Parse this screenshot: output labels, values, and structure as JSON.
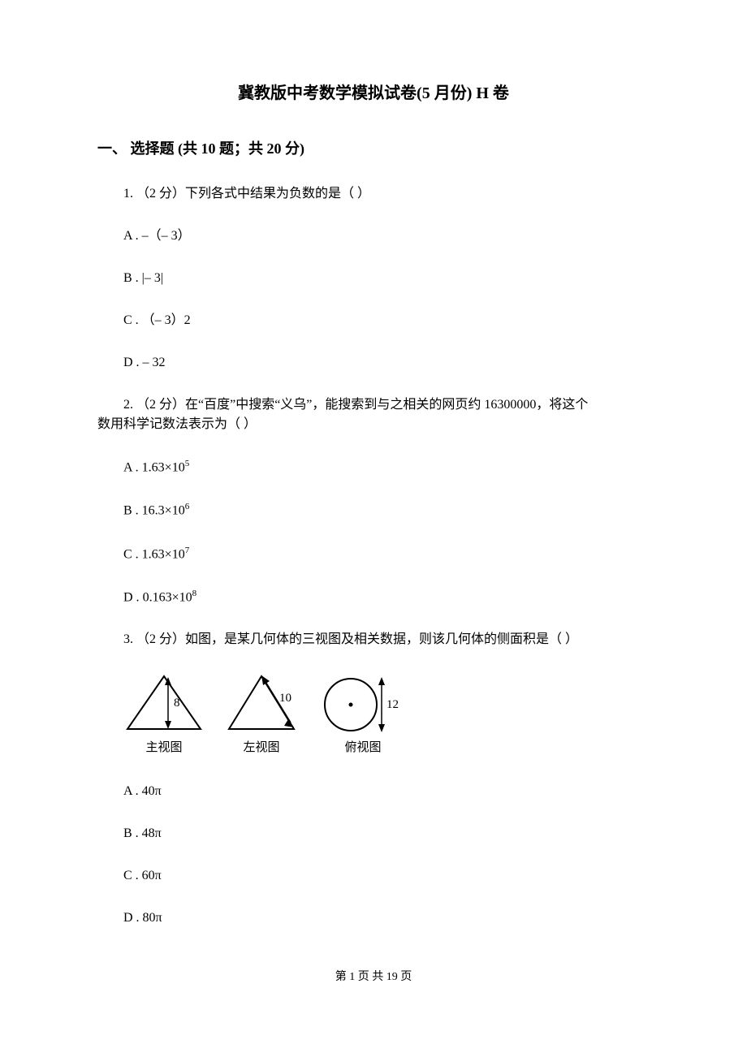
{
  "title": "冀教版中考数学模拟试卷(5 月份)  H 卷",
  "section1": {
    "heading": "一、 选择题 (共 10 题；共 20 分)"
  },
  "q1": {
    "stem": "1. （2 分）下列各式中结果为负数的是（     ）",
    "A": "A . –（– 3）",
    "B": "B . |– 3|",
    "C": "C . （– 3）2",
    "D": "D . – 32"
  },
  "q2": {
    "stem_line1": "2. （2 分）在“百度”中搜索“义乌”，能搜索到与之相关的网页约 16300000，将这个",
    "stem_line2": "数用科学记数法表示为（     ）",
    "A_prefix": "A . ",
    "A_val_base": "1.63×10",
    "A_val_exp": "5",
    "B_prefix": "B . ",
    "B_val_base": "16.3×10",
    "B_val_exp": "6",
    "C_prefix": "C . ",
    "C_val_base": "1.63×10",
    "C_val_exp": "7",
    "D_prefix": "D . ",
    "D_val_base": "0.163×10",
    "D_val_exp": "8"
  },
  "q3": {
    "stem": "3. （2 分）如图，是某几何体的三视图及相关数据，则该几何体的侧面积是（     ）",
    "fig_main_h": "8",
    "fig_left_slant": "10",
    "fig_top_d": "12",
    "label_main": "主视图",
    "label_left": "左视图",
    "label_top": "俯视图",
    "A": "A . 40π",
    "B": "B . 48π",
    "C": "C . 60π",
    "D": "D . 80π"
  },
  "footer": "第 1 页 共 19 页"
}
